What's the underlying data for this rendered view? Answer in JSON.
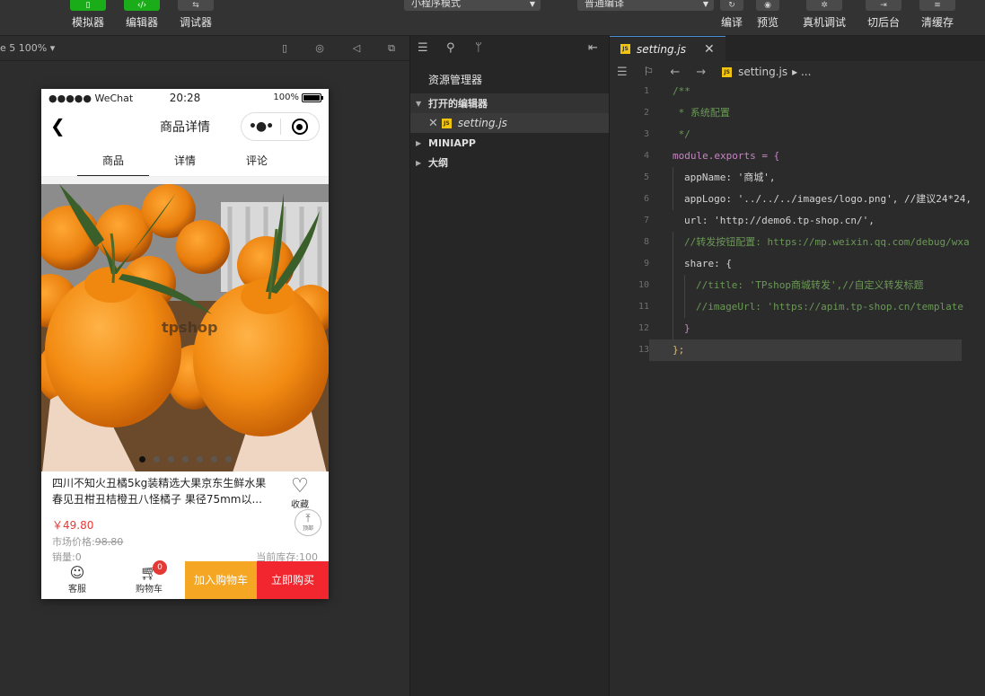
{
  "toolbar": {
    "simulator_label": "模拟器",
    "editor_label": "编辑器",
    "debugger_label": "调试器",
    "mode_select": "小程序模式",
    "compile_select": "普通编译",
    "compile_label": "编译",
    "preview_label": "预览",
    "remote_debug_label": "真机调试",
    "background_label": "切后台",
    "clear_cache_label": "清缓存"
  },
  "simulator": {
    "zoom_label": "e 5 100% ▾",
    "status": {
      "carrier": "●●●●● WeChat",
      "time": "20:28",
      "battery": "100%"
    },
    "nav_title": "商品详情",
    "tabs": [
      "商品",
      "详情",
      "评论"
    ],
    "watermark": "tpshop",
    "product": {
      "title": "四川不知火丑橘5kg装精选大果京东生鲜水果春见丑柑丑桔橙丑八怪橘子 果径75mm以...",
      "fav_label": "收藏",
      "to_top_label": "顶部",
      "price": "￥49.80",
      "market_price_label": "市场价格:",
      "market_price": "98.80",
      "sales": "销量:0",
      "stock": "当前库存:100"
    },
    "bottom": {
      "service_label": "客服",
      "cart_label": "购物车",
      "cart_badge": "0",
      "add_cart_label": "加入购物车",
      "buy_now_label": "立即购买"
    }
  },
  "explorer": {
    "title": "资源管理器",
    "open_editors_label": "打开的编辑器",
    "open_file": "setting.js",
    "miniapp_label": "MINIAPP",
    "outline_label": "大纲"
  },
  "editor": {
    "tab_name": "setting.js",
    "breadcrumb_file": "setting.js",
    "breadcrumb_more": "▸ ...",
    "lines": [
      {
        "n": "1",
        "text": "/**"
      },
      {
        "n": "2",
        "text": " * 系统配置"
      },
      {
        "n": "3",
        "text": " */"
      },
      {
        "n": "4",
        "text": "module.exports = {"
      },
      {
        "n": "5",
        "text": "appName: '商城',"
      },
      {
        "n": "6",
        "text": "appLogo: '../../../images/logo.png', //建议24*24,"
      },
      {
        "n": "7",
        "text": "url: 'http://demo6.tp-shop.cn/',"
      },
      {
        "n": "8",
        "text": "//转发按钮配置: https://mp.weixin.qq.com/debug/wxa"
      },
      {
        "n": "9",
        "text": "share: {"
      },
      {
        "n": "10",
        "text": "//title: 'TPshop商城转发',//自定义转发标题"
      },
      {
        "n": "11",
        "text": "//imageUrl: 'https://apim.tp-shop.cn/template"
      },
      {
        "n": "12",
        "text": "}"
      },
      {
        "n": "13",
        "text": "};"
      }
    ]
  },
  "colors": {
    "accent_green": "#1aad19",
    "price_red": "#e53935",
    "add_cart_orange": "#f5a623",
    "buy_now_red": "#f2262f",
    "js_badge_yellow": "#f1c40f"
  }
}
